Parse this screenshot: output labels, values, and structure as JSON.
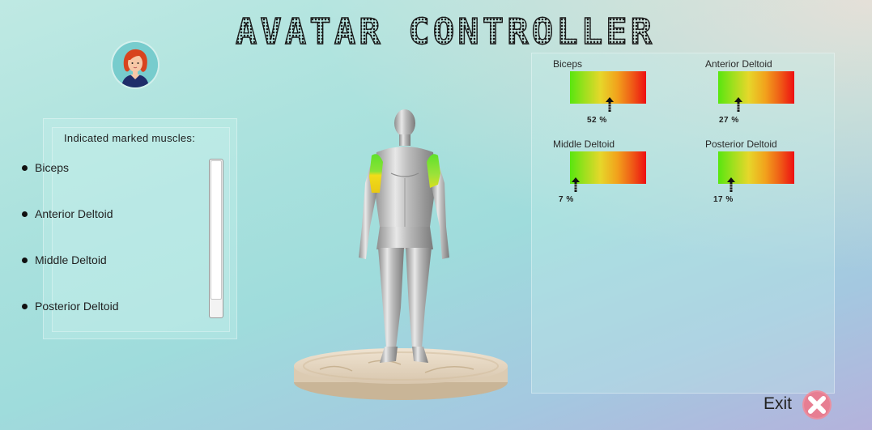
{
  "app": {
    "title": "AVATAR CONTROLLER"
  },
  "left_panel": {
    "heading": "Indicated marked muscles:",
    "items": [
      {
        "label": "Biceps"
      },
      {
        "label": "Anterior Deltoid"
      },
      {
        "label": "Middle Deltoid"
      },
      {
        "label": "Posterior Deltoid"
      }
    ]
  },
  "gauges": [
    {
      "label": "Biceps",
      "percent_text": "52 %",
      "value": 0.52
    },
    {
      "label": "Anterior Deltoid",
      "percent_text": "27 %",
      "value": 0.27
    },
    {
      "label": "Middle Deltoid",
      "percent_text": "7 %",
      "value": 0.07
    },
    {
      "label": "Posterior Deltoid",
      "percent_text": "17 %",
      "value": 0.17
    }
  ],
  "exit": {
    "label": "Exit"
  },
  "colors": {
    "gauge_low": "#59e60f",
    "gauge_mid": "#e6d72a",
    "gauge_high": "#ee0f12",
    "highlight_green": "#6fe12a",
    "highlight_yellow": "#f0dc1a",
    "exit_red": "#ea8fa0"
  },
  "icons": {
    "avatar": "user-avatar-icon",
    "exit": "close-x-icon",
    "arrow": "up-arrow-icon"
  }
}
